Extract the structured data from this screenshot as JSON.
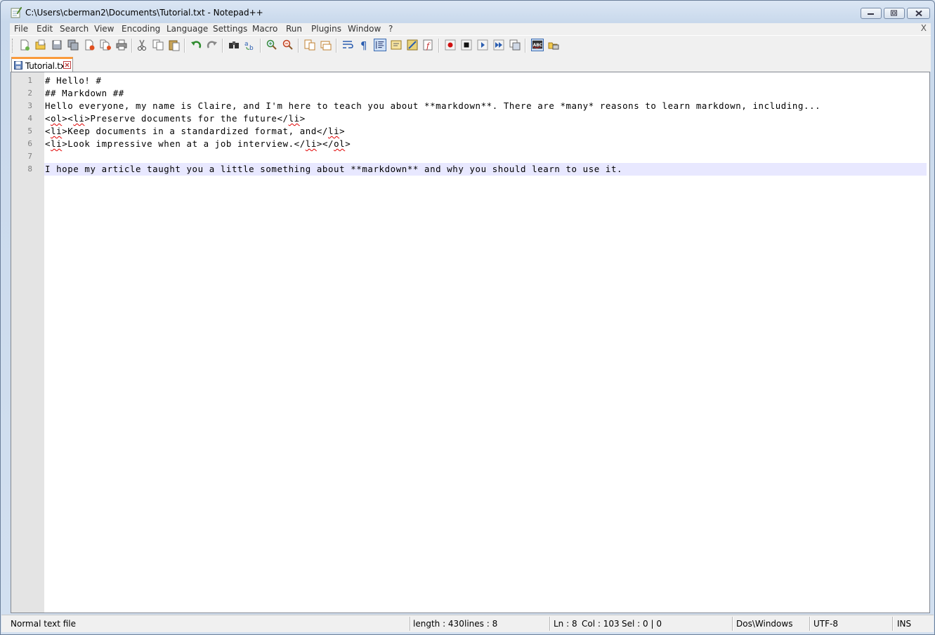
{
  "window": {
    "title": "C:\\Users\\cberman2\\Documents\\Tutorial.txt - Notepad++"
  },
  "menu": {
    "items": [
      "File",
      "Edit",
      "Search",
      "View",
      "Encoding",
      "Language",
      "Settings",
      "Macro",
      "Run",
      "Plugins",
      "Window",
      "?"
    ],
    "close_label": "X"
  },
  "toolbar": {
    "icons": [
      "new-file-icon",
      "open-file-icon",
      "save-icon",
      "save-all-icon",
      "close-icon",
      "close-all-icon",
      "print-icon",
      "cut-icon",
      "copy-icon",
      "paste-icon",
      "undo-icon",
      "redo-icon",
      "find-icon",
      "replace-icon",
      "zoom-in-icon",
      "zoom-out-icon",
      "sync-vertical-icon",
      "sync-horizontal-icon",
      "word-wrap-icon",
      "show-all-chars-icon",
      "indent-guide-icon",
      "user-lang-icon",
      "doc-map-icon",
      "function-list-icon",
      "record-macro-icon",
      "stop-macro-icon",
      "play-macro-icon",
      "run-macro-multiple-icon",
      "save-macro-icon",
      "spellcheck-icon",
      "plugin-icon"
    ]
  },
  "tabs": [
    {
      "label": "Tutorial.txt",
      "active": true
    }
  ],
  "editor": {
    "current_line": 8,
    "line_numbers": [
      "1",
      "2",
      "3",
      "4",
      "5",
      "6",
      "7",
      "8"
    ],
    "lines": [
      "# Hello! #",
      "## Markdown ##",
      "Hello everyone, my name is Claire, and I'm here to teach you about **markdown**. There are *many* reasons to learn markdown, including...",
      "<ol><li>Preserve documents for the future</li>",
      "<li>Keep documents in a standardized format, and</li>",
      "<li>Look impressive when at a job interview.</li></ol>",
      "",
      "I hope my article taught you a little something about **markdown** and why you should learn to use it."
    ],
    "current_line_color": "#e8e8ff",
    "spell_error_color": "#e00000"
  },
  "status": {
    "file_type": "Normal text file",
    "length": "length : 430",
    "lines": "lines : 8",
    "ln": "Ln : 8",
    "col": "Col : 103",
    "sel": "Sel : 0 | 0",
    "eol": "Dos\\Windows",
    "encoding": "UTF-8",
    "mode": "INS"
  },
  "colors": {
    "tab_accent": "#fa9a3c",
    "window_frame": "#c9d9ec",
    "gutter": "#e4e4e4"
  }
}
